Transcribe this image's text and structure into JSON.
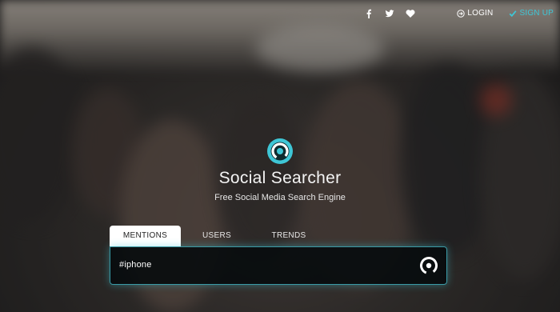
{
  "app": {
    "title": "Social Searcher",
    "tagline": "Free Social Media Search Engine"
  },
  "header": {
    "social_icons": [
      "facebook-icon",
      "twitter-icon",
      "heart-icon"
    ],
    "login_label": "LOGIN",
    "signup_label": "SIGN UP"
  },
  "search": {
    "tabs": [
      {
        "label": "MENTIONS",
        "active": true
      },
      {
        "label": "USERS",
        "active": false
      },
      {
        "label": "TRENDS",
        "active": false
      }
    ],
    "query": "#iphone"
  },
  "colors": {
    "accent": "#3ec6d6",
    "search_bg": "#0a0e10"
  }
}
